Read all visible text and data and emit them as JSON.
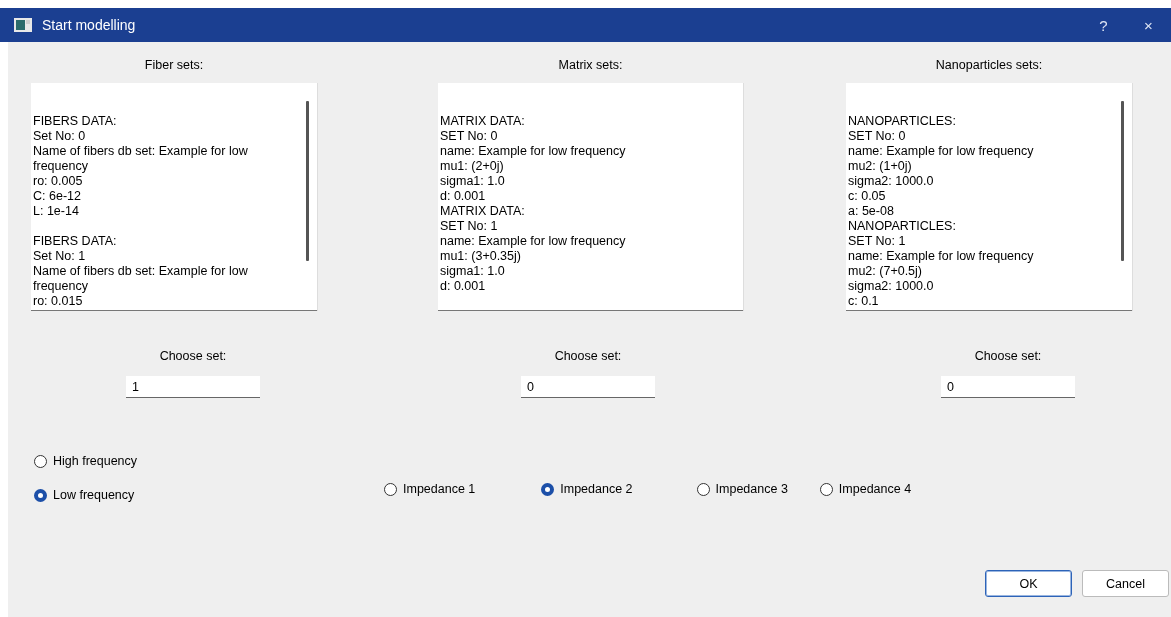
{
  "window": {
    "title": "Start modelling",
    "help": "?",
    "close": "×"
  },
  "sets": [
    {
      "heading": "Fiber sets:",
      "scrollable": true,
      "blank_line_between": true,
      "records": [
        {
          "lines": [
            "FIBERS DATA:",
            "Set No: 0",
            "Name of fibers db set: Example for low frequency",
            "ro: 0.005",
            "C: 6e-12",
            "L: 1e-14"
          ]
        },
        {
          "lines": [
            "FIBERS DATA:",
            "Set No: 1",
            "Name of fibers db set: Example for low frequency",
            "ro: 0.015"
          ]
        }
      ]
    },
    {
      "heading": "Matrix sets:",
      "scrollable": false,
      "blank_line_between": false,
      "records": [
        {
          "lines": [
            "MATRIX DATA:",
            "SET No: 0",
            "name: Example for low frequency",
            "mu1: (2+0j)",
            "sigma1: 1.0",
            "d: 0.001"
          ]
        },
        {
          "lines": [
            "MATRIX DATA:",
            "SET No: 1",
            "name: Example for low frequency",
            "mu1: (3+0.35j)",
            "sigma1: 1.0",
            "d: 0.001"
          ]
        }
      ]
    },
    {
      "heading": "Nanoparticles sets:",
      "scrollable": true,
      "blank_line_between": false,
      "records": [
        {
          "lines": [
            "NANOPARTICLES:",
            "SET No: 0",
            "name: Example for low frequency",
            "mu2: (1+0j)",
            "sigma2: 1000.0",
            "c: 0.05",
            "a: 5e-08"
          ]
        },
        {
          "lines": [
            "NANOPARTICLES:",
            "SET No: 1",
            "name: Example for low frequency",
            "mu2: (7+0.5j)",
            "sigma2: 1000.0",
            "c: 0.1"
          ]
        }
      ]
    }
  ],
  "choosers": [
    {
      "label": "Choose set:",
      "value": "1"
    },
    {
      "label": "Choose set:",
      "value": "0"
    },
    {
      "label": "Choose set:",
      "value": "0"
    }
  ],
  "frequency": [
    {
      "label": "High frequency",
      "selected": false
    },
    {
      "label": "Low frequency",
      "selected": true
    }
  ],
  "impedance": [
    {
      "label": "Impedance 1",
      "selected": false
    },
    {
      "label": "Impedance 2",
      "selected": true
    },
    {
      "label": "Impedance 3",
      "selected": false
    },
    {
      "label": "Impedance 4",
      "selected": false
    }
  ],
  "buttons": [
    {
      "label": "OK",
      "default": true
    },
    {
      "label": "Cancel",
      "default": false
    }
  ]
}
